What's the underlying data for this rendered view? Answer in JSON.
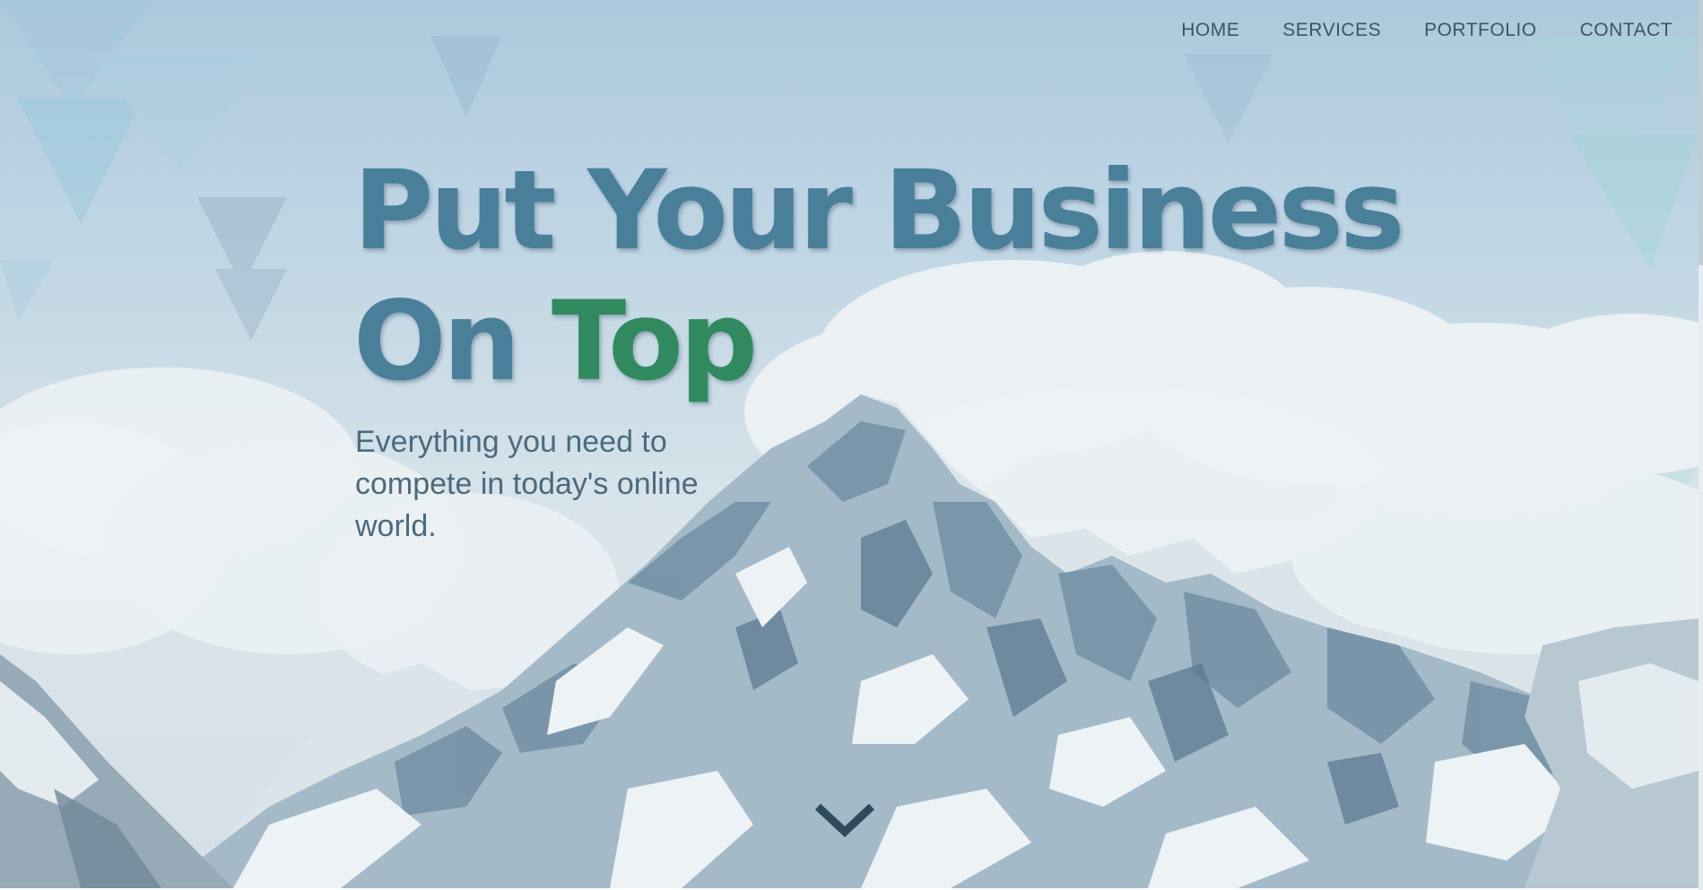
{
  "nav": {
    "items": [
      {
        "label": "HOME"
      },
      {
        "label": "SERVICES"
      },
      {
        "label": "PORTFOLIO"
      },
      {
        "label": "CONTACT"
      }
    ]
  },
  "hero": {
    "headline_line1": "Put Your Business",
    "headline_line2_prefix": "On ",
    "headline_line2_accent": "Top",
    "tagline": "Everything you need to compete in today's online world.",
    "background": "snowy-mountain-peaks-with-clouds",
    "scroll_icon": "chevron-down-icon"
  },
  "colors": {
    "headline": "#4a7f99",
    "accent": "#318a5f",
    "nav_text": "#3a5568",
    "tagline": "#4c6a7e",
    "chevron": "#2f4a5c"
  }
}
